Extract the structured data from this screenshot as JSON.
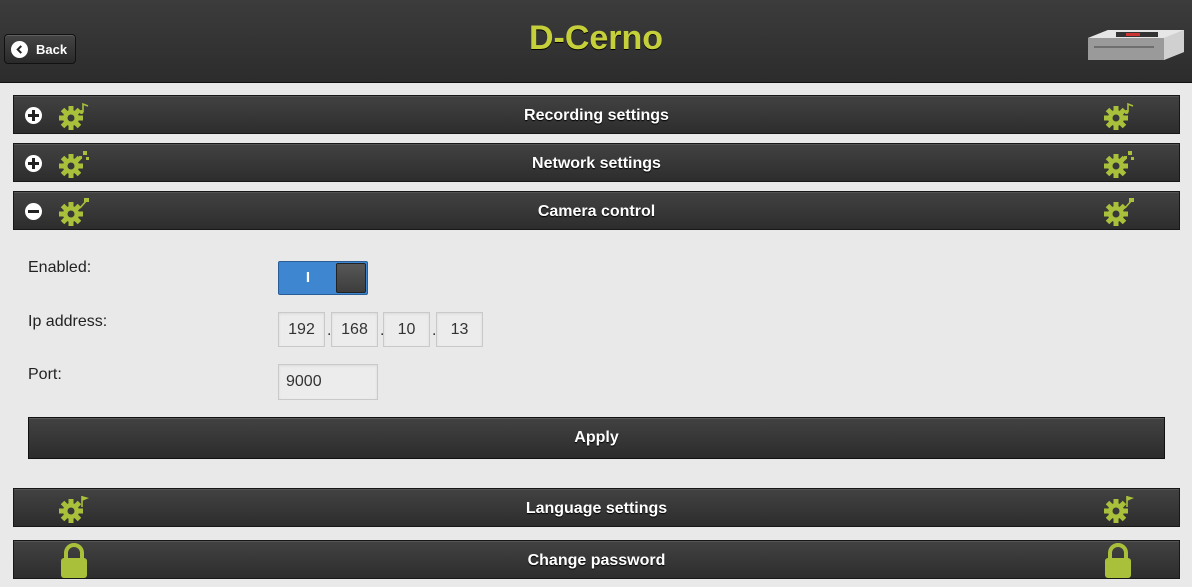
{
  "header": {
    "title": "D-Cerno",
    "back_label": "Back"
  },
  "sections": [
    {
      "label": "Recording settings",
      "toggle": "+",
      "icon": "gear-music-icon"
    },
    {
      "label": "Network settings",
      "toggle": "+",
      "icon": "gear-network-icon"
    },
    {
      "label": "Camera control",
      "toggle": "−",
      "icon": "gear-camera-icon"
    },
    {
      "label": "Language settings",
      "icon": "gear-flag-icon"
    },
    {
      "label": "Change password",
      "icon": "lock-icon"
    }
  ],
  "camera_control": {
    "enabled_label": "Enabled:",
    "enabled_switch_text": "I",
    "ip_label": "Ip address:",
    "ip_octets": [
      "192",
      "168",
      "10",
      "13"
    ],
    "port_label": "Port:",
    "port_value": "9000",
    "apply_label": "Apply"
  },
  "colors": {
    "accent": "#c5cf3a",
    "switch_on": "#3f86d1",
    "bar_dark": "#333333",
    "background": "#e9e9e9"
  }
}
